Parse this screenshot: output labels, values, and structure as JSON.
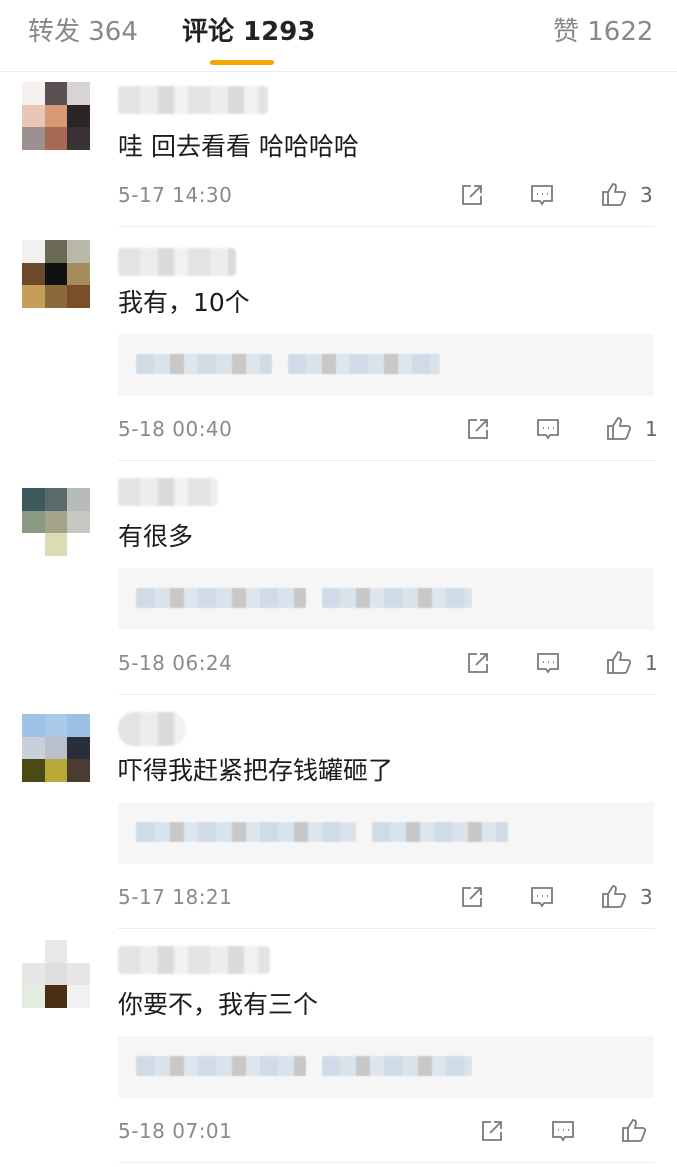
{
  "tabs": {
    "forward_label": "转发 364",
    "comments_label": "评论 1293",
    "likes_label": "赞 1622",
    "accent_color": "#f7a600"
  },
  "comments": [
    {
      "text": "哇 回去看看 哈哈哈哈",
      "time": "5-17 14:30",
      "likes": "3"
    },
    {
      "text": "我有，10个",
      "time": "5-18 00:40",
      "likes": "1"
    },
    {
      "text": "有很多",
      "time": "5-18 06:24",
      "likes": "1"
    },
    {
      "text": "吓得我赶紧把存钱罐砸了",
      "time": "5-17 18:21",
      "likes": "3"
    },
    {
      "text": "你要不，我有三个",
      "time": "5-18 07:01",
      "likes": ""
    }
  ],
  "icons": {
    "share": "share-icon",
    "comment": "comment-icon",
    "like": "thumbs-up-icon"
  }
}
